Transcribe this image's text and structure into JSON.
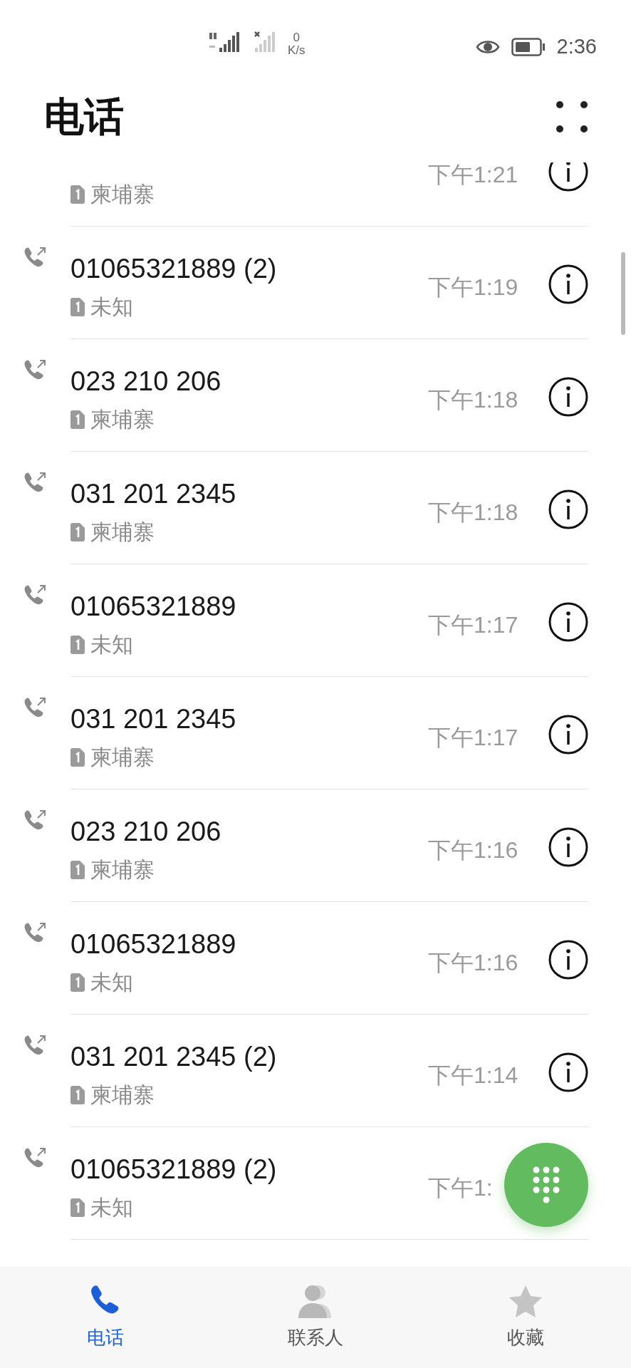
{
  "status_bar": {
    "net_speed_value": "0",
    "net_speed_unit": "K/s",
    "time": "2:36"
  },
  "header": {
    "title": "电话"
  },
  "calls": [
    {
      "kind": "partial",
      "location": "柬埔寨",
      "time": "下午1:21"
    },
    {
      "kind": "full",
      "number": "01065321889 (2)",
      "location": "未知",
      "time": "下午1:19"
    },
    {
      "kind": "full",
      "number": "023 210 206",
      "location": "柬埔寨",
      "time": "下午1:18"
    },
    {
      "kind": "full",
      "number": "031 201 2345",
      "location": "柬埔寨",
      "time": "下午1:18"
    },
    {
      "kind": "full",
      "number": "01065321889",
      "location": "未知",
      "time": "下午1:17"
    },
    {
      "kind": "full",
      "number": "031 201 2345",
      "location": "柬埔寨",
      "time": "下午1:17"
    },
    {
      "kind": "full",
      "number": "023 210 206",
      "location": "柬埔寨",
      "time": "下午1:16"
    },
    {
      "kind": "full",
      "number": "01065321889",
      "location": "未知",
      "time": "下午1:16"
    },
    {
      "kind": "full",
      "number": "031 201 2345 (2)",
      "location": "柬埔寨",
      "time": "下午1:14"
    },
    {
      "kind": "covered",
      "number": "01065321889 (2)",
      "location": "未知",
      "time": "下午1:"
    }
  ],
  "tabs": [
    {
      "kind": "phone",
      "label": "电话",
      "selected": true
    },
    {
      "kind": "contacts",
      "label": "联系人",
      "selected": false
    },
    {
      "kind": "favorites",
      "label": "收藏",
      "selected": false
    }
  ]
}
